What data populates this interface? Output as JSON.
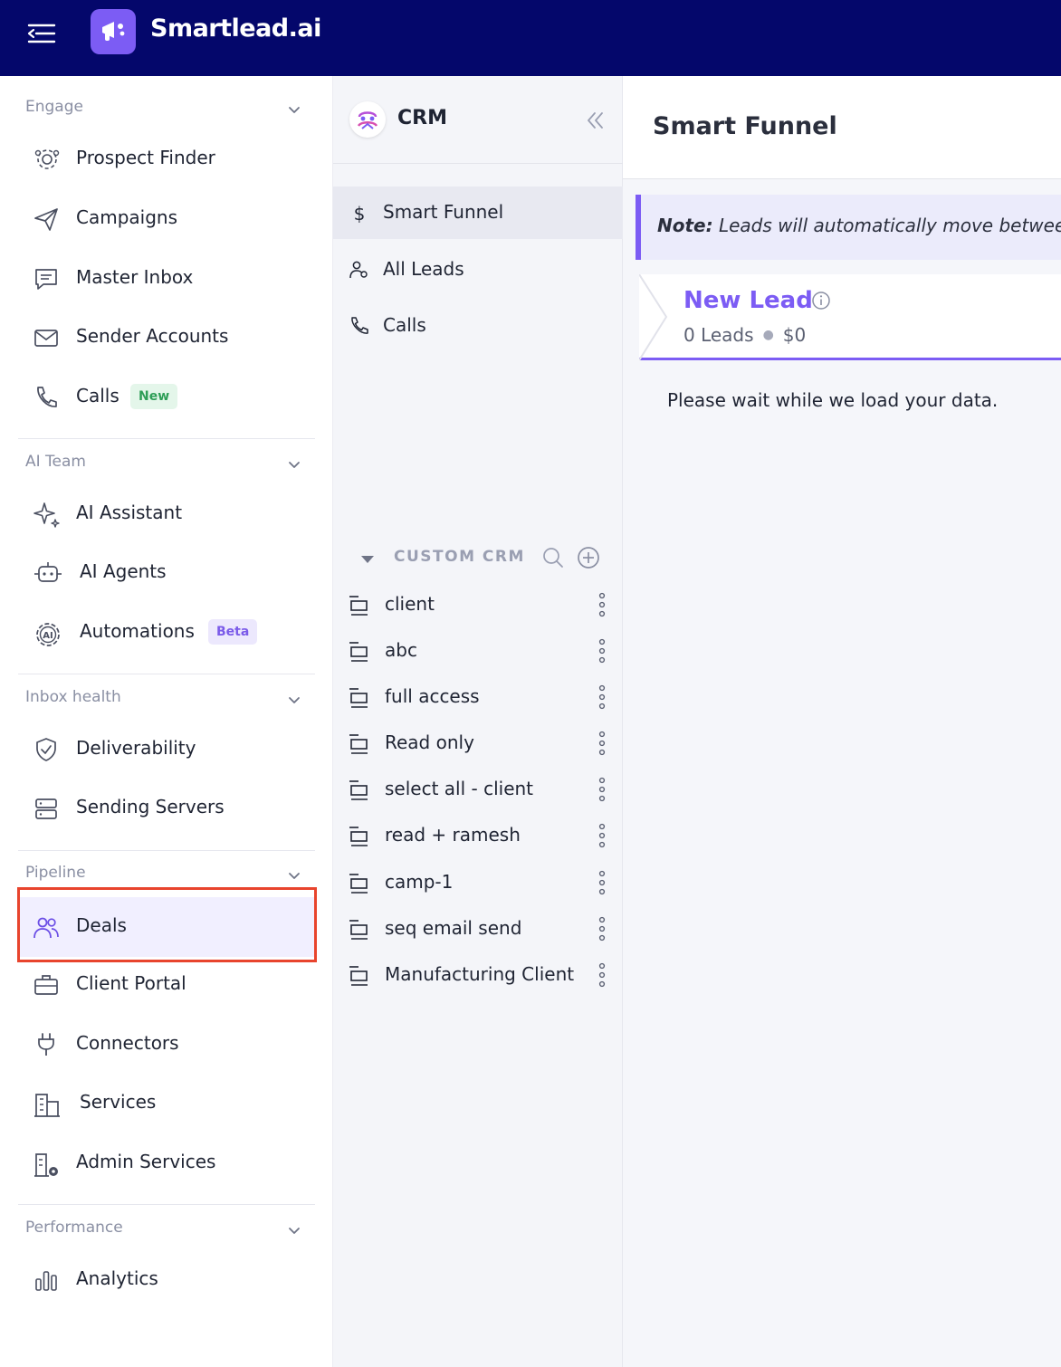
{
  "app": {
    "brand": "Smartlead.ai"
  },
  "sidebar": {
    "sections": [
      {
        "title": "Engage",
        "items": [
          {
            "label": "Prospect Finder",
            "icon": "users-gear-icon"
          },
          {
            "label": "Campaigns",
            "icon": "send-icon"
          },
          {
            "label": "Master Inbox",
            "icon": "message-icon"
          },
          {
            "label": "Sender Accounts",
            "icon": "mail-icon"
          },
          {
            "label": "Calls",
            "icon": "phone-icon",
            "badge": "New"
          }
        ]
      },
      {
        "title": "AI Team",
        "items": [
          {
            "label": "AI Assistant",
            "icon": "sparkle-icon"
          },
          {
            "label": "AI Agents",
            "icon": "robot-icon"
          },
          {
            "label": "Automations",
            "icon": "ai-gear-icon",
            "badge": "Beta"
          }
        ]
      },
      {
        "title": "Inbox health",
        "items": [
          {
            "label": "Deliverability",
            "icon": "shield-check-icon"
          },
          {
            "label": "Sending Servers",
            "icon": "server-icon"
          }
        ]
      },
      {
        "title": "Pipeline",
        "items": [
          {
            "label": "Deals",
            "icon": "users-icon",
            "active": true
          },
          {
            "label": "Client Portal",
            "icon": "briefcase-icon"
          },
          {
            "label": "Connectors",
            "icon": "plug-icon"
          },
          {
            "label": "Services",
            "icon": "building-icon"
          },
          {
            "label": "Admin Services",
            "icon": "building-settings-icon"
          }
        ]
      },
      {
        "title": "Performance",
        "items": [
          {
            "label": "Analytics",
            "icon": "bar-chart-icon"
          }
        ]
      }
    ]
  },
  "crm": {
    "title": "CRM",
    "links": [
      {
        "label": "Smart Funnel",
        "icon": "dollar-icon",
        "active": true
      },
      {
        "label": "All Leads",
        "icon": "users-icon"
      },
      {
        "label": "Calls",
        "icon": "phone-icon"
      }
    ],
    "custom_heading": "CUSTOM CRM",
    "custom_items": [
      "client",
      "abc",
      "full access",
      "Read only",
      "select all - client",
      "read + ramesh",
      "camp-1",
      "seq email send",
      "Manufacturing Client"
    ]
  },
  "main": {
    "title": "Smart Funnel",
    "note_label": "Note:",
    "note_text": " Leads will automatically move betwee",
    "stage": {
      "name": "New Lead",
      "count": "0 Leads",
      "value": "$0"
    },
    "loading_text": "Please wait while we load your data."
  },
  "colors": {
    "topbar": "#04076b",
    "accent": "#7c5cf4",
    "highlight": "#e8442d"
  }
}
